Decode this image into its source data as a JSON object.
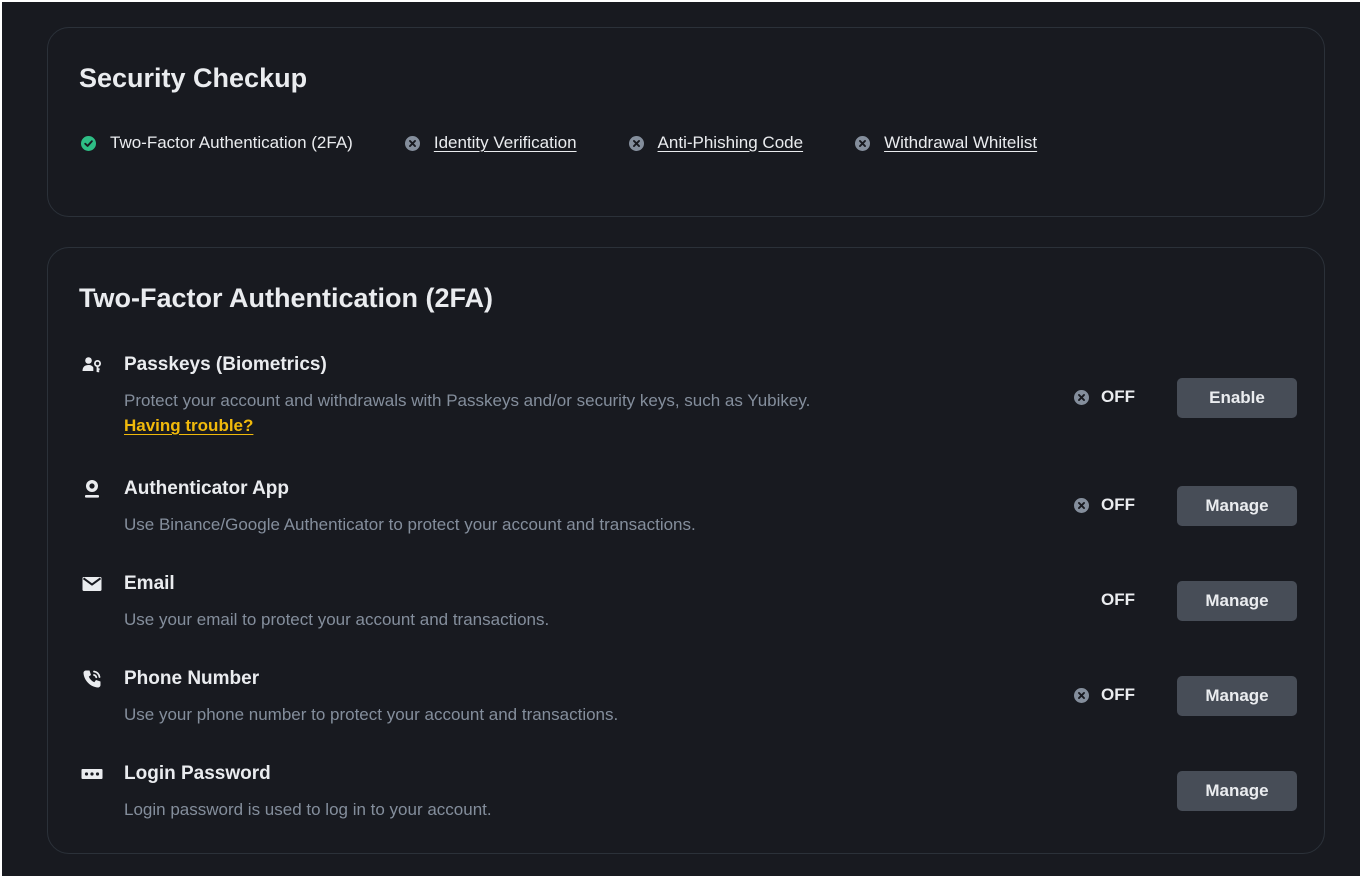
{
  "checkup": {
    "title": "Security Checkup",
    "items": [
      {
        "label": "Two-Factor Authentication (2FA)",
        "status": "done",
        "icon": "check-circle-icon"
      },
      {
        "label": "Identity Verification",
        "status": "missing",
        "icon": "x-circle-icon"
      },
      {
        "label": "Anti-Phishing Code",
        "status": "missing",
        "icon": "x-circle-icon"
      },
      {
        "label": "Withdrawal Whitelist",
        "status": "missing",
        "icon": "x-circle-icon"
      }
    ]
  },
  "twofa": {
    "title": "Two-Factor Authentication (2FA)",
    "methods": [
      {
        "name": "Passkeys (Biometrics)",
        "icon": "passkey-icon",
        "description": "Protect your account and withdrawals with Passkeys and/or security keys, such as Yubikey.",
        "link": "Having trouble?",
        "status": "OFF",
        "button": "Enable"
      },
      {
        "name": "Authenticator App",
        "icon": "authenticator-icon",
        "description": "Use Binance/Google Authenticator to protect your account and transactions.",
        "status": "OFF",
        "button": "Manage"
      },
      {
        "name": "Email",
        "icon": "email-icon",
        "description": "Use your email to protect your account and transactions.",
        "status": "OFF",
        "button": "Manage"
      },
      {
        "name": "Phone Number",
        "icon": "phone-icon",
        "description": "Use your phone number to protect your account and transactions.",
        "status": "OFF",
        "button": "Manage"
      },
      {
        "name": "Login Password",
        "icon": "password-icon",
        "description": "Login password is used to log in to your account.",
        "button": "Manage"
      }
    ]
  },
  "colors": {
    "background": "#181a20",
    "card_border": "#2b3139",
    "text_primary": "#eaecef",
    "text_secondary": "#848e9c",
    "link_accent": "#f0b90b",
    "success": "#2ebd85",
    "muted_icon": "#848e9c",
    "button_bg": "#474d57"
  }
}
